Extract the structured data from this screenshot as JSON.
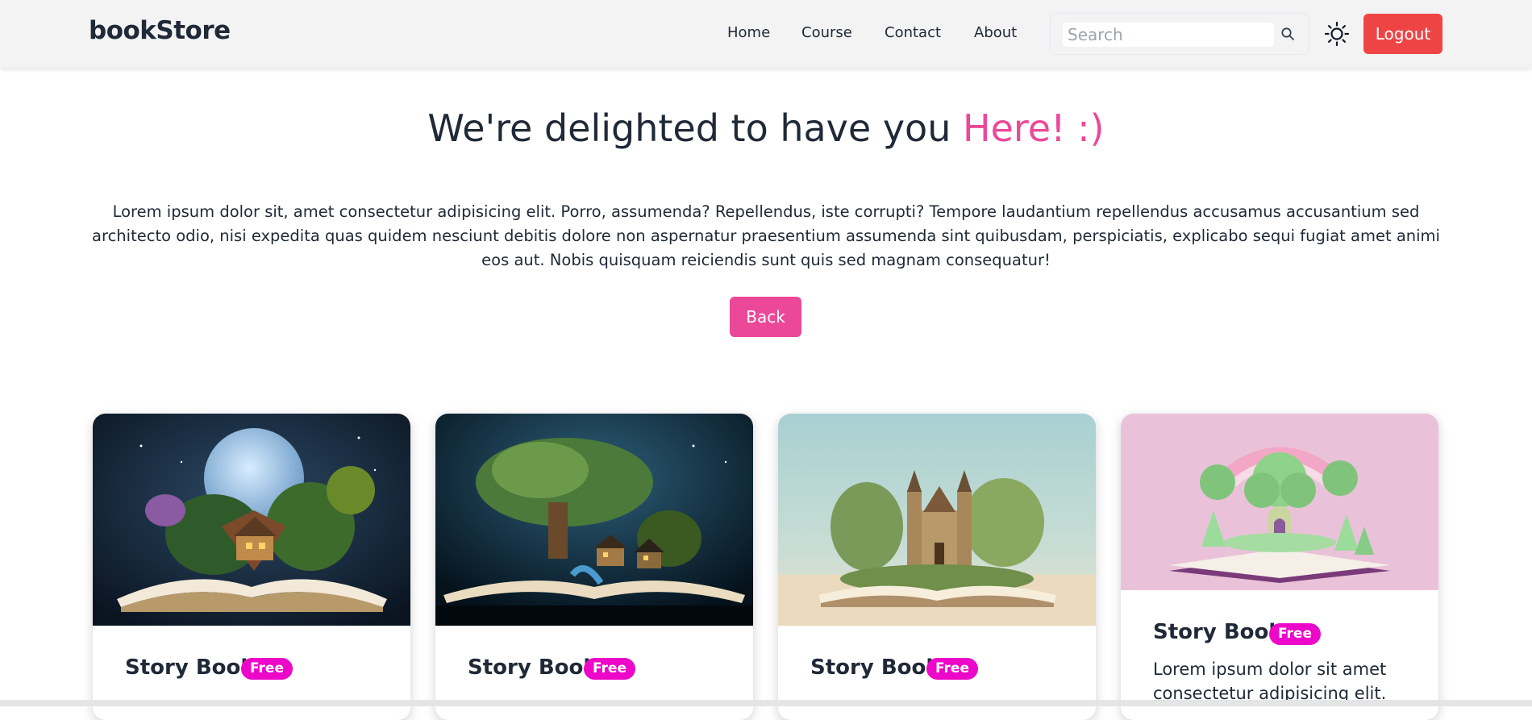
{
  "navbar": {
    "brand": "bookStore",
    "links": [
      "Home",
      "Course",
      "Contact",
      "About"
    ],
    "search_placeholder": "Search",
    "logout_label": "Logout"
  },
  "hero": {
    "headline_main": "We're delighted to have you",
    "headline_accent": "Here! :)",
    "intro": "Lorem ipsum dolor sit, amet consectetur adipisicing elit. Porro, assumenda? Repellendus, iste corrupti? Tempore laudantium repellendus accusamus accusantium sed architecto odio, nisi expedita quas quidem nesciunt debitis dolore non aspernatur praesentium assumenda sint quibusdam, perspiciatis, explicabo sequi fugiat amet animi eos aut. Nobis quisquam reiciendis sunt quis sed magnam consequatur!",
    "back_label": "Back"
  },
  "cards": [
    {
      "title": "Story Book",
      "badge": "Free",
      "desc": ""
    },
    {
      "title": "Story Book",
      "badge": "Free",
      "desc": ""
    },
    {
      "title": "Story Book",
      "badge": "Free",
      "desc": ""
    },
    {
      "title": "Story Book",
      "badge": "Free",
      "desc": "Lorem ipsum dolor sit amet consectetur adipisicing elit."
    }
  ],
  "colors": {
    "accent_pink": "#ec4899",
    "badge_magenta": "#ec07c9",
    "logout_red": "#ef4444",
    "navbar_bg": "#f3f3f3",
    "text_dark": "#1f2937"
  },
  "icons": [
    "search-icon",
    "sun-icon"
  ]
}
